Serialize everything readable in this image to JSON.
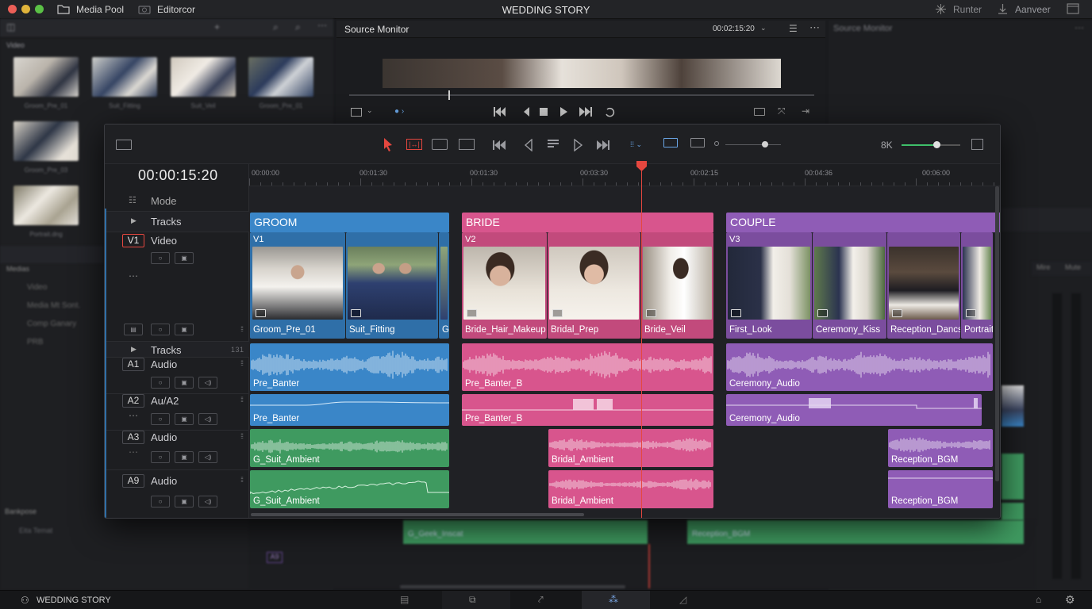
{
  "window": {
    "title": "WEDDING STORY",
    "tab_media_pool": "Media Pool",
    "tab_editor": "Editorcor",
    "btn_render": "Runter",
    "btn_export": "Aanveer"
  },
  "media_pool": {
    "section": "Video",
    "thumbs": [
      "Groom_Pre_01",
      "Suit_Fitting",
      "Suit_Veil",
      "Groom_Pre_01",
      "Groom_Pre_03",
      "Portrait.dng"
    ],
    "side_items": [
      "Medias",
      "Video",
      "Media Mt Sont.",
      "Comp Ganary",
      "PRB"
    ],
    "lower_items": [
      "Bankpose",
      "Eita Temat"
    ]
  },
  "source_monitor": {
    "title": "Source Monitor",
    "timecode": "00:02:15:20",
    "right_title": "Source Monitor"
  },
  "timeline": {
    "timecode": "00:00:15:20",
    "zoom_label": "8K",
    "ruler_labels": [
      "00:00:00",
      "00:01:30",
      "00:01:30",
      "00:03:30",
      "00:02:15",
      "00:04:36",
      "00:06:00"
    ],
    "header": {
      "mode": "Mode",
      "tracks_label": "Tracks",
      "tracks_label2": "Tracks",
      "tracks_count": "1 3 1",
      "v1_id": "V1",
      "v1_name": "Video",
      "a1_id": "A1",
      "a1_name": "Audio",
      "a2_id": "A2",
      "a2_name": "Au/A2",
      "a3_id": "A3",
      "a3_name": "Audio",
      "a9_id": "A9",
      "a9_name": "Audio"
    },
    "groups": [
      {
        "label": "GROOM",
        "track": "V1"
      },
      {
        "label": "BRIDE",
        "track": "V2"
      },
      {
        "label": "COUPLE",
        "track": "V3"
      }
    ],
    "video_clips": [
      "Groom_Pre_01",
      "Suit_Fitting",
      "G",
      "Bride_Hair_Makeup",
      "Bridal_Prep",
      "Bride_Veil",
      "First_Look",
      "Ceremony_Kiss",
      "Reception_Dancs",
      "Portrait"
    ],
    "audio_clips": {
      "a1": [
        "Pre_Banter",
        "Pre_Banter_B",
        "Ceremony_Audio"
      ],
      "a2": [
        "Pre_Banter",
        "Pre_Banter_B",
        "Ceremony_Audio"
      ],
      "a3": [
        "G_Suit_Ambient",
        "Bridal_Ambient",
        "Reception_BGM"
      ],
      "a9": [
        "G_Suit_Ambient",
        "Bridal_Ambient",
        "Reception_BGM"
      ]
    },
    "colors": {
      "groom": "#3a86c8",
      "bride": "#d8558d",
      "couple": "#8f5cb6",
      "ambient": "#3f9a60",
      "playhead": "#e5473f"
    }
  },
  "background_timeline": {
    "clips": [
      "G_Geek_Inscat",
      "Reception_BGM"
    ],
    "track": "A9"
  },
  "right_meters": {
    "labels": [
      "Mire",
      "Mute"
    ]
  },
  "bottom": {
    "project": "WEDDING STORY"
  }
}
